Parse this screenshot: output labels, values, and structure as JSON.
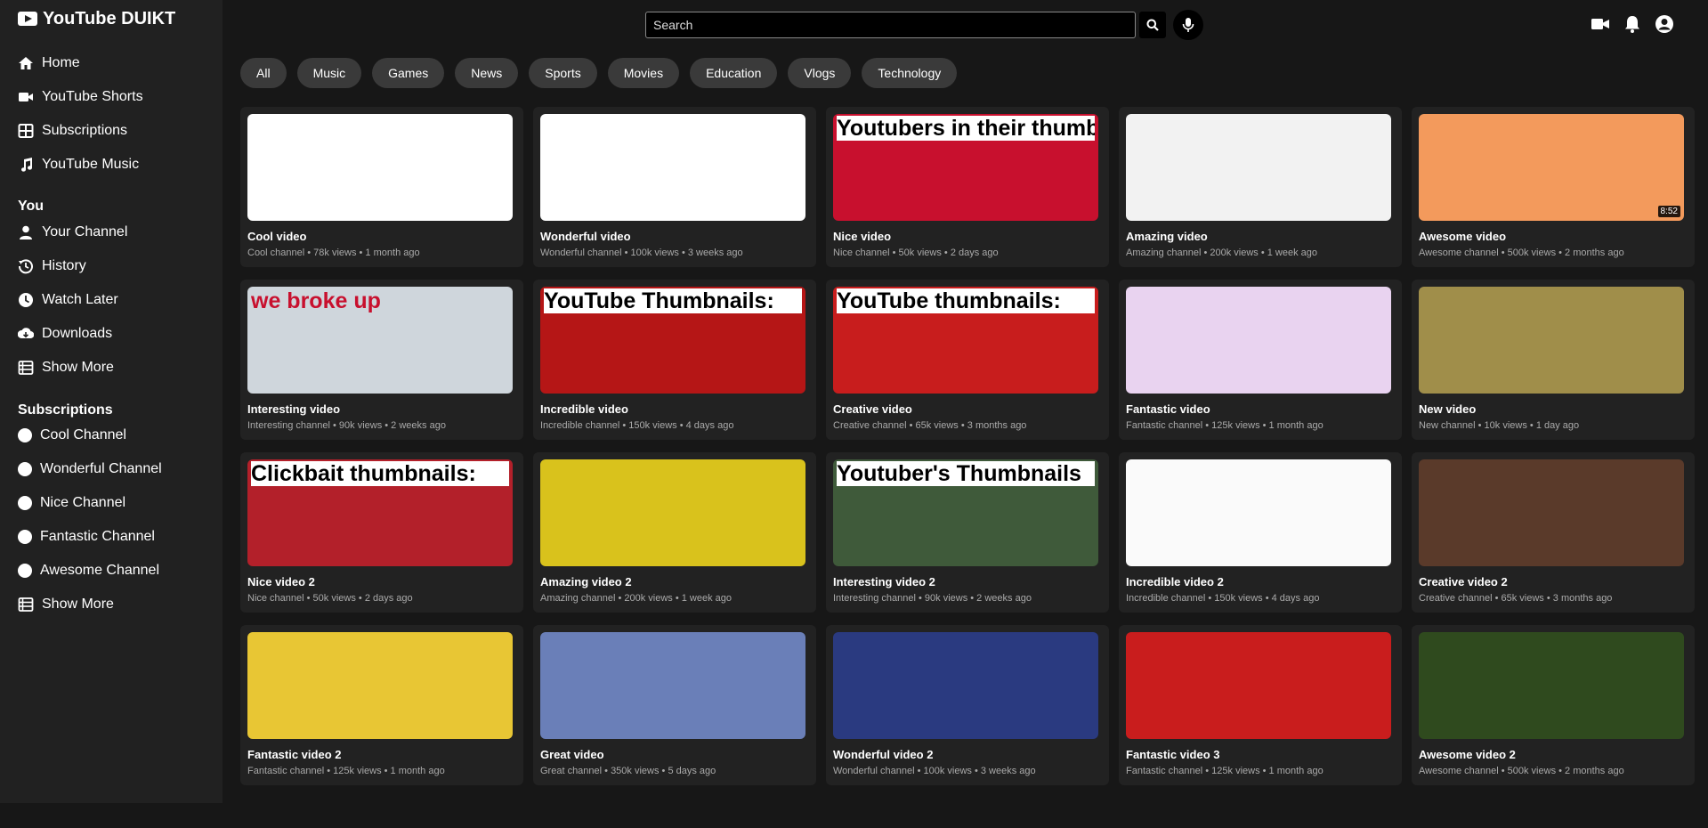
{
  "app": {
    "title": "YouTube DUIKT"
  },
  "sidebar": {
    "main": [
      {
        "label": "Home",
        "icon": "home-icon"
      },
      {
        "label": "YouTube Shorts",
        "icon": "video-camera-icon"
      },
      {
        "label": "Subscriptions",
        "icon": "grid-icon"
      },
      {
        "label": "YouTube Music",
        "icon": "music-note-icon"
      }
    ],
    "you_heading": "You",
    "you": [
      {
        "label": "Your Channel",
        "icon": "user-icon"
      },
      {
        "label": "History",
        "icon": "history-icon"
      },
      {
        "label": "Watch Later",
        "icon": "clock-icon"
      },
      {
        "label": "Downloads",
        "icon": "download-icon"
      },
      {
        "label": "Show More",
        "icon": "list-icon"
      }
    ],
    "subs_heading": "Subscriptions",
    "subs": [
      {
        "label": "Cool Channel"
      },
      {
        "label": "Wonderful Channel"
      },
      {
        "label": "Nice Channel"
      },
      {
        "label": "Fantastic Channel"
      },
      {
        "label": "Awesome Channel"
      }
    ],
    "subs_more": "Show More"
  },
  "search": {
    "placeholder": "Search"
  },
  "chips": [
    "All",
    "Music",
    "Games",
    "News",
    "Sports",
    "Movies",
    "Education",
    "Vlogs",
    "Technology"
  ],
  "videos": [
    {
      "title": "Cool video",
      "meta": "Cool channel • 78k views • 1 month ago",
      "thumb_bg": "#ffffff",
      "thumb_text": ""
    },
    {
      "title": "Wonderful video",
      "meta": "Wonderful channel • 100k views • 3 weeks ago",
      "thumb_bg": "#ffffff",
      "thumb_text": ""
    },
    {
      "title": "Nice video",
      "meta": "Nice channel • 50k views • 2 days ago",
      "thumb_bg": "#c8102e",
      "thumb_text": "Youtubers in their thumbnails:"
    },
    {
      "title": "Amazing video",
      "meta": "Amazing channel • 200k views • 1 week ago",
      "thumb_bg": "#f2f2f2",
      "thumb_text": ""
    },
    {
      "title": "Awesome video",
      "meta": "Awesome channel • 500k views • 2 months ago",
      "thumb_bg": "#f39a5c",
      "thumb_text": "",
      "duration": "8:52"
    },
    {
      "title": "Interesting video",
      "meta": "Interesting channel • 90k views • 2 weeks ago",
      "thumb_bg": "#cfd6dc",
      "thumb_text": "we broke up"
    },
    {
      "title": "Incredible video",
      "meta": "Incredible channel • 150k views • 4 days ago",
      "thumb_bg": "#b51616",
      "thumb_text": "YouTube Thumbnails:"
    },
    {
      "title": "Creative video",
      "meta": "Creative channel • 65k views • 3 months ago",
      "thumb_bg": "#c81d1d",
      "thumb_text": "YouTube thumbnails:"
    },
    {
      "title": "Fantastic video",
      "meta": "Fantastic channel • 125k views • 1 month ago",
      "thumb_bg": "#e9d3f0",
      "thumb_text": ""
    },
    {
      "title": "New video",
      "meta": "New channel • 10k views • 1 day ago",
      "thumb_bg": "#a08e4a",
      "thumb_text": ""
    },
    {
      "title": "Nice video 2",
      "meta": "Nice channel • 50k views • 2 days ago",
      "thumb_bg": "#b3202a",
      "thumb_text": "Clickbait thumbnails:"
    },
    {
      "title": "Amazing video 2",
      "meta": "Amazing channel • 200k views • 1 week ago",
      "thumb_bg": "#d9c21c",
      "thumb_text": ""
    },
    {
      "title": "Interesting video 2",
      "meta": "Interesting channel • 90k views • 2 weeks ago",
      "thumb_bg": "#3f5a3a",
      "thumb_text": "Youtuber's Thumbnails"
    },
    {
      "title": "Incredible video 2",
      "meta": "Incredible channel • 150k views • 4 days ago",
      "thumb_bg": "#fafafa",
      "thumb_text": ""
    },
    {
      "title": "Creative video 2",
      "meta": "Creative channel • 65k views • 3 months ago",
      "thumb_bg": "#5a3a2a",
      "thumb_text": ""
    },
    {
      "title": "Fantastic video 2",
      "meta": "Fantastic channel • 125k views • 1 month ago",
      "thumb_bg": "#e8c634",
      "thumb_text": ""
    },
    {
      "title": "Great video",
      "meta": "Great channel • 350k views • 5 days ago",
      "thumb_bg": "#6a7fb8",
      "thumb_text": ""
    },
    {
      "title": "Wonderful video 2",
      "meta": "Wonderful channel • 100k views • 3 weeks ago",
      "thumb_bg": "#2a3a80",
      "thumb_text": ""
    },
    {
      "title": "Fantastic video 3",
      "meta": "Fantastic channel • 125k views • 1 month ago",
      "thumb_bg": "#c91d1d",
      "thumb_text": ""
    },
    {
      "title": "Awesome video 2",
      "meta": "Awesome channel • 500k views • 2 months ago",
      "thumb_bg": "#2f4a1e",
      "thumb_text": ""
    }
  ]
}
